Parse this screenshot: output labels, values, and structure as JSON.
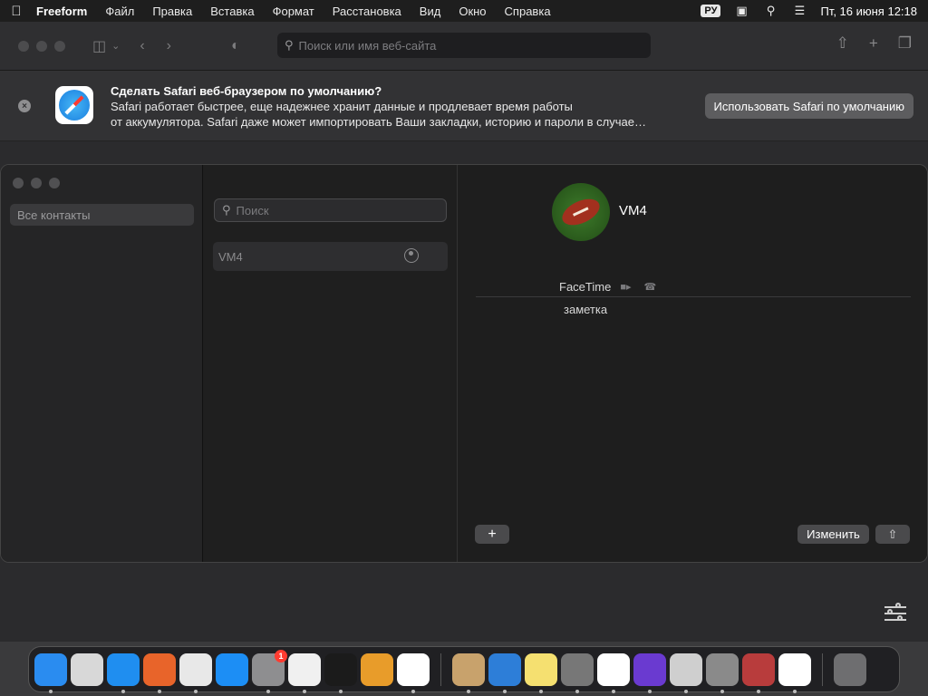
{
  "menubar": {
    "app_name": "Freeform",
    "items": [
      "Файл",
      "Правка",
      "Вставка",
      "Формат",
      "Расстановка",
      "Вид",
      "Окно",
      "Справка"
    ],
    "input_source": "РУ",
    "datetime": "Пт, 16 июня  12:18"
  },
  "safari": {
    "url_placeholder": "Поиск или имя веб-сайта",
    "banner": {
      "title": "Сделать Safari веб-браузером по умолчанию?",
      "line1": "Safari работает быстрее, еще надежнее хранит данные и продлевает время работы",
      "line2": "от аккумулятора. Safari даже может импортировать Ваши закладки, историю и пароли в случае…",
      "button": "Использовать Safari по умолчанию"
    }
  },
  "contacts": {
    "sidebar": {
      "all_contacts": "Все контакты"
    },
    "search_placeholder": "Поиск",
    "list": [
      {
        "name": "VM4"
      }
    ],
    "detail": {
      "name": "VM4",
      "facetime_label": "FaceTime",
      "note_label": "заметка",
      "add_label": "+",
      "edit_label": "Изменить"
    }
  },
  "dock": {
    "apps": [
      {
        "name": "Finder",
        "color": "#2a8cf0",
        "running": true
      },
      {
        "name": "Launchpad",
        "color": "#d8d8d8",
        "running": false
      },
      {
        "name": "Safari",
        "color": "#1f8ef0",
        "running": true
      },
      {
        "name": "Firefox",
        "color": "#e8642a",
        "running": true
      },
      {
        "name": "Chrome",
        "color": "#e8e8e8",
        "running": true
      },
      {
        "name": "App Store",
        "color": "#1c8ef5",
        "running": false
      },
      {
        "name": "System Settings",
        "color": "#8e8e90",
        "running": true,
        "badge": "1"
      },
      {
        "name": "TextEdit",
        "color": "#f0f0f0",
        "running": true
      },
      {
        "name": "Terminal",
        "color": "#1b1b1b",
        "running": true
      },
      {
        "name": "GarageBand",
        "color": "#e89c2a",
        "running": false
      },
      {
        "name": "VS Code",
        "color": "#ffffff",
        "running": true
      },
      {
        "name": "Contacts",
        "color": "#c8a26c",
        "running": true
      },
      {
        "name": "Weather",
        "color": "#2d7ed8",
        "running": true
      },
      {
        "name": "Notes",
        "color": "#f5e070",
        "running": true
      },
      {
        "name": "Screenshot",
        "color": "#777777",
        "running": true
      },
      {
        "name": "Reminders",
        "color": "#ffffff",
        "running": true
      },
      {
        "name": "Shortcuts",
        "color": "#6a3ad0",
        "running": true
      },
      {
        "name": "Font Book",
        "color": "#cfcfcf",
        "running": true
      },
      {
        "name": "Chess",
        "color": "#8a8a8a",
        "running": true
      },
      {
        "name": "Dictionary",
        "color": "#b83c3c",
        "running": true
      },
      {
        "name": "Freeform",
        "color": "#ffffff",
        "running": true
      },
      {
        "name": "Trash",
        "color": "#6e6e70",
        "running": false
      }
    ]
  }
}
